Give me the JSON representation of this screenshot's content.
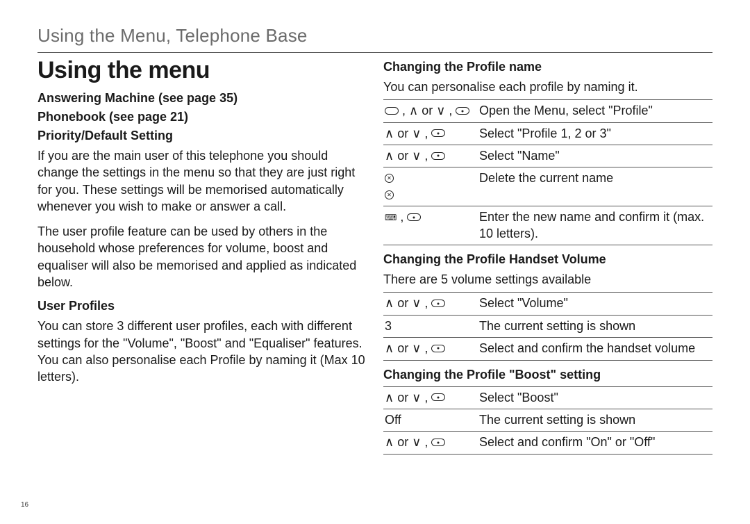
{
  "header": "Using the Menu, Telephone Base",
  "title": "Using the menu",
  "page_number": "16",
  "left": {
    "answering_machine": "Answering Machine (see page 35)",
    "phonebook": "Phonebook (see page 21)",
    "priority_heading": "Priority/Default Setting",
    "priority_para1": "If you are the main user of this telephone you should change the settings in the menu so that they are just right for you. These settings will be memorised automatically whenever you wish to make or answer a call.",
    "priority_para2": "The user profile feature can be used by others in the household whose preferences for volume, boost and equaliser will also be memorised and applied as indicated below.",
    "user_profiles_heading": "User Profiles",
    "user_profiles_para": "You can store 3 different user profiles, each with different settings for the \"Volume\", \"Boost\" and \"Equaliser\" features. You can also personalise each Profile by naming it (Max 10 letters)."
  },
  "right": {
    "profile_name_heading": "Changing the Profile name",
    "profile_name_intro": "You can personalise each profile by naming it.",
    "profile_name_steps": [
      {
        "key_html": "<span class='softkey'></span> , <span class='sym'>∧</span> or <span class='sym'>∨</span> , <span class='softkey dot'></span>",
        "desc": "Open the Menu, select \"Profile\""
      },
      {
        "key_html": "<span class='sym'>∧</span> or <span class='sym'>∨</span> , <span class='softkey dot'></span>",
        "desc": "Select \"Profile 1, 2 or 3\""
      },
      {
        "key_html": "<span class='sym'>∧</span> or <span class='sym'>∨</span> , <span class='softkey dot'></span>",
        "desc": "Select \"Name\""
      },
      {
        "key_html": "<span class='x-circle'></span><br><span class='x-circle'></span>",
        "desc": "Delete the current name"
      },
      {
        "key_html": "<span class='keypad'>⌨</span> , <span class='softkey dot'></span>",
        "desc": "Enter the new name and confirm it (max. 10 letters)."
      }
    ],
    "handset_vol_heading": "Changing the Profile Handset Volume",
    "handset_vol_intro": "There are 5 volume settings available",
    "handset_vol_steps": [
      {
        "key_html": "<span class='sym'>∧</span> or <span class='sym'>∨</span> , <span class='softkey dot'></span>",
        "desc": "Select \"Volume\""
      },
      {
        "key_html": "3",
        "desc": "The current setting is shown"
      },
      {
        "key_html": "<span class='sym'>∧</span> or <span class='sym'>∨</span> , <span class='softkey dot'></span>",
        "desc": "Select and confirm the handset volume"
      }
    ],
    "boost_heading": "Changing the Profile \"Boost\" setting",
    "boost_steps": [
      {
        "key_html": "<span class='sym'>∧</span> or <span class='sym'>∨</span> , <span class='softkey dot'></span>",
        "desc": "Select \"Boost\""
      },
      {
        "key_html": "Off",
        "desc": "The current setting is shown"
      },
      {
        "key_html": "<span class='sym'>∧</span> or <span class='sym'>∨</span> , <span class='softkey dot'></span>",
        "desc": "Select and confirm \"On\" or \"Off\""
      }
    ]
  }
}
